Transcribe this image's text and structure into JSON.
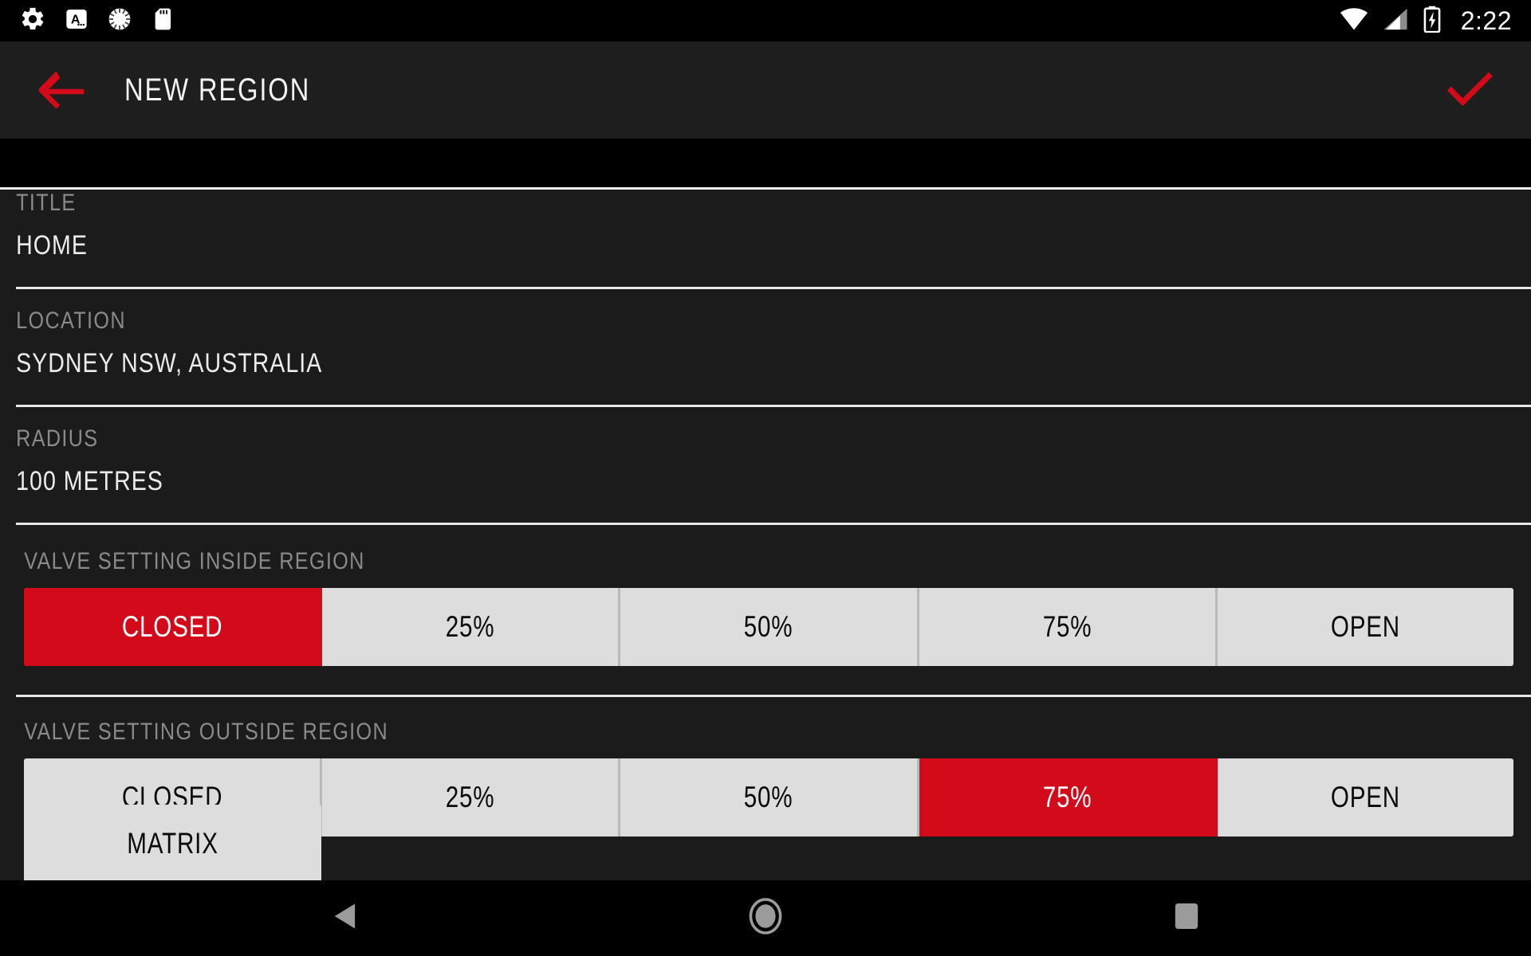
{
  "status_bar": {
    "icons_left": [
      "gear-icon",
      "keyboard-a-icon",
      "spinner-icon",
      "sd-card-icon"
    ],
    "icons_right": [
      "wifi-icon",
      "cellular-signal-icon",
      "battery-charging-icon"
    ],
    "time": "2:22"
  },
  "app_bar": {
    "back_icon": "arrow-left-icon",
    "title": "NEW REGION",
    "confirm_icon": "check-icon",
    "accent_color": "#d20a1a"
  },
  "form": {
    "fields": [
      {
        "label": "TITLE",
        "value": "HOME"
      },
      {
        "label": "LOCATION",
        "value": "SYDNEY NSW, AUSTRALIA"
      },
      {
        "label": "RADIUS",
        "value": "100 METRES"
      }
    ]
  },
  "valve_inside": {
    "label": "VALVE SETTING INSIDE REGION",
    "options": [
      "CLOSED",
      "25%",
      "50%",
      "75%",
      "OPEN"
    ],
    "selected_index": 0,
    "selected_value": "CLOSED"
  },
  "valve_outside": {
    "label": "VALVE SETTING OUTSIDE REGION",
    "options": [
      "CLOSED",
      "25%",
      "50%",
      "75%",
      "OPEN"
    ],
    "selected_index": 3,
    "selected_value": "75%"
  },
  "matrix_button": {
    "label": "MATRIX"
  },
  "nav_bar": {
    "back_icon": "nav-back-triangle-icon",
    "home_icon": "nav-home-circle-icon",
    "recents_icon": "nav-recents-square-icon"
  },
  "colors": {
    "accent_red": "#d20a1a",
    "background": "#1b1b1b",
    "app_bar_bg": "#1e1e1e",
    "segment_bg": "#dddddd",
    "label_gray": "#8a8a8a"
  }
}
